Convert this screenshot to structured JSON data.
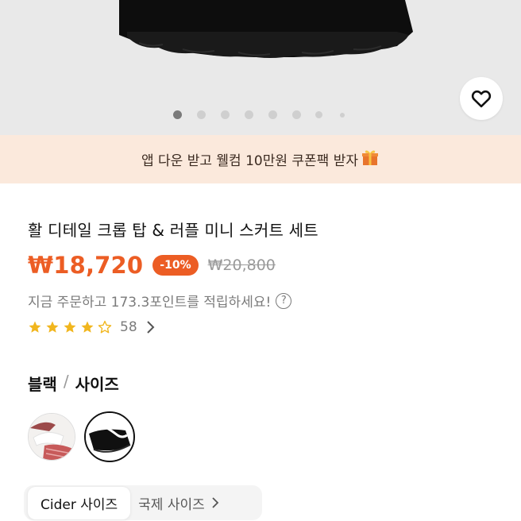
{
  "gallery": {
    "image_count": 8,
    "active_index": 0,
    "favorite_icon": "heart-outline-icon"
  },
  "promo": {
    "text": "앱 다운 받고 웰컴 10만원 쿠폰팩 받자",
    "icon": "gift-icon"
  },
  "product": {
    "title": "활 디테일 크롭 탑 & 러플 미니 스커트 세트",
    "price": "₩18,720",
    "discount": "-10%",
    "original_price": "₩20,800",
    "points_text": "지금 주문하고 173.3포인트를 적립하세요!",
    "rating": 4.5,
    "review_count": "58"
  },
  "options": {
    "color": "블랙",
    "separator": "/",
    "size_label": "사이즈",
    "swatches": [
      {
        "name": "white-red",
        "selected": false
      },
      {
        "name": "black",
        "selected": true
      }
    ]
  },
  "size_tabs": {
    "active": "Cider 사이즈",
    "other": "국제 사이즈"
  },
  "colors": {
    "accent": "#ec5d24",
    "promo_bg": "#fbe9dc",
    "gallery_bg": "#e9e9e9"
  }
}
